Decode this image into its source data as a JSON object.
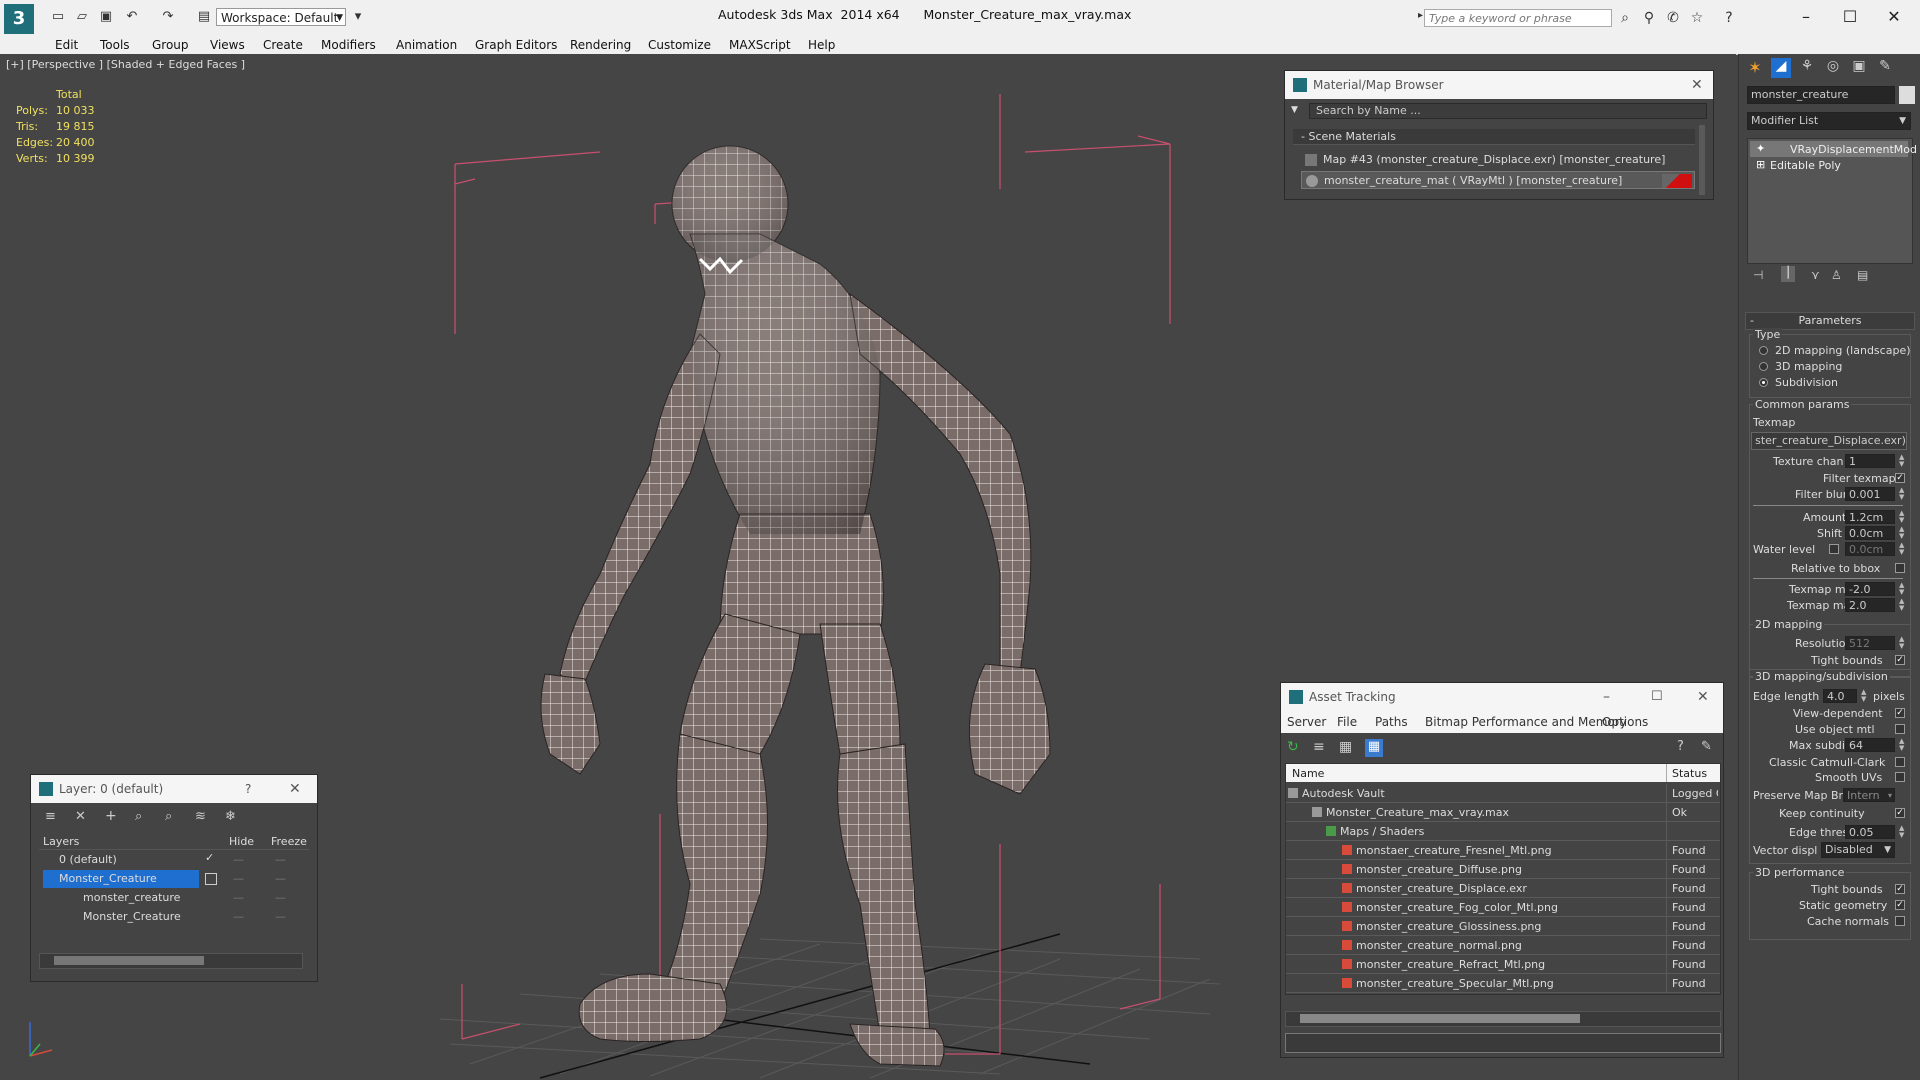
{
  "titlebar": {
    "workspace": "Workspace: Default",
    "app_name": "Autodesk 3ds Max  2014 x64",
    "file_name": "Monster_Creature_max_vray.max",
    "search_placeholder": "Type a keyword or phrase"
  },
  "menubar": [
    "Edit",
    "Tools",
    "Group",
    "Views",
    "Create",
    "Modifiers",
    "Animation",
    "Graph Editors",
    "Rendering",
    "Customize",
    "MAXScript",
    "Help"
  ],
  "viewport": {
    "label": "[+] [Perspective ] [Shaded + Edged Faces ]",
    "stats": {
      "header": "Total",
      "rows": [
        {
          "label": "Polys:",
          "value": "10 033"
        },
        {
          "label": "Tris:",
          "value": "19 815"
        },
        {
          "label": "Edges:",
          "value": "20 400"
        },
        {
          "label": "Verts:",
          "value": "10 399"
        }
      ]
    }
  },
  "material_browser": {
    "title": "Material/Map Browser",
    "search_placeholder": "Search by Name ...",
    "section": "Scene Materials",
    "items": [
      "Map #43 (monster_creature_Displace.exr)  [monster_creature]",
      "monster_creature_mat  ( VRayMtl )  [monster_creature]"
    ]
  },
  "layer_panel": {
    "title": "Layer: 0 (default)",
    "help": "?",
    "columns": [
      "Layers",
      "Hide",
      "Freeze"
    ],
    "rows": [
      "0 (default)",
      "Monster_Creature",
      "monster_creature",
      "Monster_Creature"
    ]
  },
  "asset_tracking": {
    "title": "Asset Tracking",
    "menu": [
      "Server",
      "File",
      "Paths",
      "Bitmap Performance and Memory",
      "Options"
    ],
    "columns": [
      "Name",
      "Status"
    ],
    "rows": [
      {
        "name": "Autodesk Vault",
        "status": "Logged Out"
      },
      {
        "name": "Monster_Creature_max_vray.max",
        "status": "Ok"
      },
      {
        "name": "Maps / Shaders",
        "status": ""
      },
      {
        "name": "monstaer_creature_Fresnel_Mtl.png",
        "status": "Found"
      },
      {
        "name": "monster_creature_Diffuse.png",
        "status": "Found"
      },
      {
        "name": "monster_creature_Displace.exr",
        "status": "Found"
      },
      {
        "name": "monster_creature_Fog_color_Mtl.png",
        "status": "Found"
      },
      {
        "name": "monster_creature_Glossiness.png",
        "status": "Found"
      },
      {
        "name": "monster_creature_normal.png",
        "status": "Found"
      },
      {
        "name": "monster_creature_Refract_Mtl.png",
        "status": "Found"
      },
      {
        "name": "monster_creature_Specular_Mtl.png",
        "status": "Found"
      }
    ]
  },
  "command_panel": {
    "object_name": "monster_creature",
    "modifier_list": "Modifier List",
    "stack": [
      "VRayDisplacementMod",
      "Editable Poly"
    ],
    "rollout_title": "Parameters",
    "type_label": "Type",
    "type_options": [
      "2D mapping (landscape)",
      "3D mapping",
      "Subdivision"
    ],
    "common_params": "Common params",
    "texmap_label": "Texmap",
    "texmap_value": "ster_creature_Displace.exr)",
    "texture_chan_label": "Texture chan",
    "texture_chan": "1",
    "filter_texmap": "Filter texmap",
    "filter_blur_label": "Filter blur",
    "filter_blur": "0.001",
    "amount_label": "Amount",
    "amount": "1.2cm",
    "shift_label": "Shift",
    "shift": "0.0cm",
    "water_level_label": "Water level",
    "water_level": "0.0cm",
    "relative_bbox": "Relative to bbox",
    "texmap_min_label": "Texmap min",
    "texmap_min": "-2.0",
    "texmap_max_label": "Texmap max",
    "texmap_max": "2.0",
    "mapping_2d": "2D mapping",
    "resolution_label": "Resolution",
    "resolution": "512",
    "tight_bounds": "Tight bounds",
    "mapping_3d_sub": "3D mapping/subdivision",
    "edge_length_label": "Edge length",
    "edge_length": "4.0",
    "pixels": "pixels",
    "view_dependent": "View-dependent",
    "use_object_mtl": "Use object mtl",
    "max_subdivs_label": "Max subdivs",
    "max_subdivs": "64",
    "classic_catmull": "Classic Catmull-Clark",
    "smooth_uvs": "Smooth UVs",
    "preserve_map_bnd_label": "Preserve Map Bnd",
    "preserve_map_bnd": "Intern",
    "keep_continuity": "Keep continuity",
    "edge_thresh_label": "Edge thresh",
    "edge_thresh": "0.05",
    "vector_displ_label": "Vector displ",
    "vector_displ": "Disabled",
    "perf_3d": "3D performance",
    "perf_tight_bounds": "Tight bounds",
    "static_geometry": "Static geometry",
    "cache_normals": "Cache normals"
  },
  "colors": {
    "viewport_bg": "#454545",
    "selection": "#1f6fd0",
    "panel": "#444444",
    "stats": "#f0e060",
    "bbox": "#c8506e"
  }
}
